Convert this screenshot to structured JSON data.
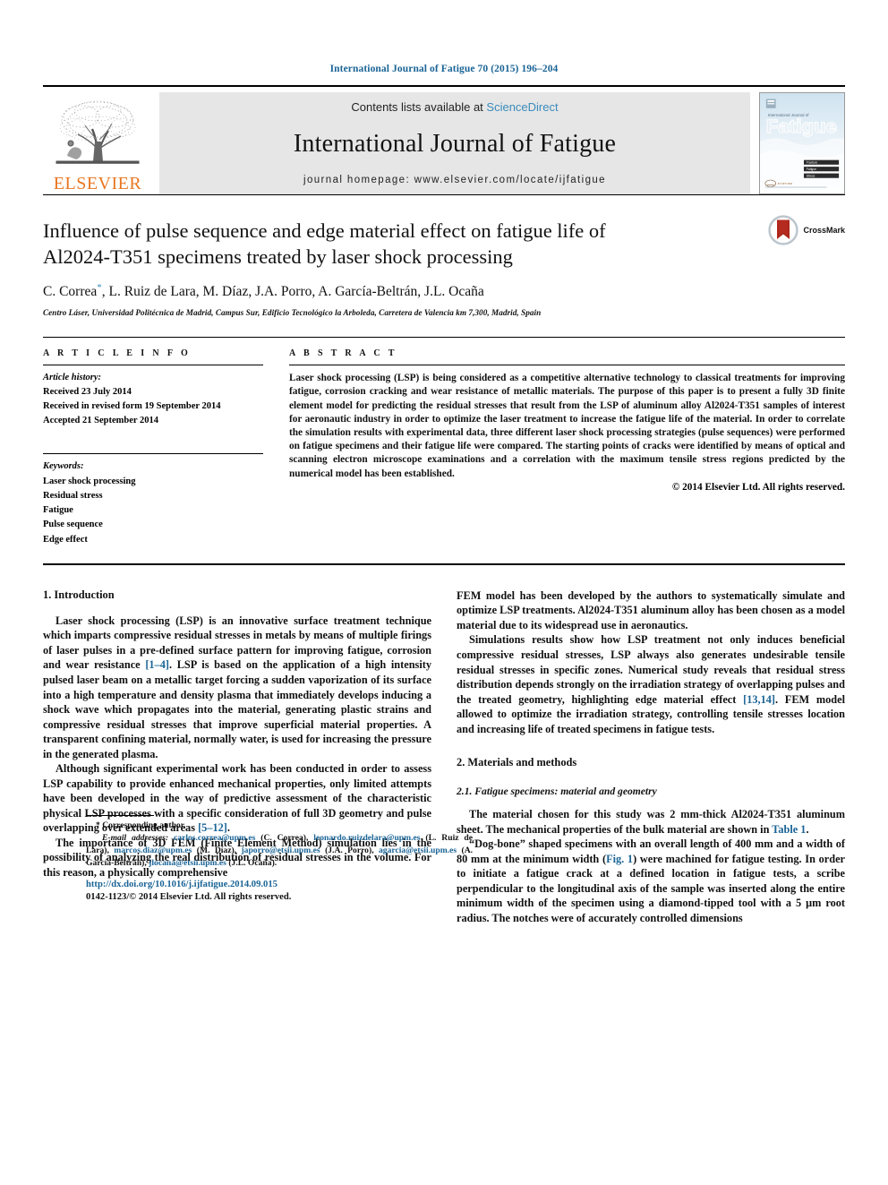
{
  "running_head": "International Journal of Fatigue 70 (2015) 196–204",
  "masthead": {
    "contents_prefix": "Contents lists available at ",
    "sciencedirect": "ScienceDirect",
    "journal_title": "International Journal of Fatigue",
    "homepage": "journal homepage: www.elsevier.com/locate/ijfatigue",
    "publisher": "ELSEVIER",
    "cover": {
      "kicker": "International Journal of",
      "title": "Fatigue",
      "bullets": [
        "Fracture",
        "Fatigue",
        "Stress"
      ]
    }
  },
  "article": {
    "title": "Influence of pulse sequence and edge material effect on fatigue life of Al2024-T351 specimens treated by laser shock processing",
    "authors": "C. Correa , L. Ruiz de Lara, M. Díaz, J.A. Porro, A. García-Beltrán, J.L. Ocaña",
    "corresponding_marker": "*",
    "affiliation": "Centro Láser, Universidad Politécnica de Madrid, Campus Sur, Edificio Tecnológico la Arboleda, Carretera de Valencia km 7,300, Madrid, Spain",
    "crossmark_label": "CrossMark"
  },
  "info": {
    "heading": "A R T I C L E    I N F O",
    "history_title": "Article history:",
    "history": [
      "Received 23 July 2014",
      "Received in revised form 19 September 2014",
      "Accepted 21 September 2014"
    ],
    "keywords_title": "Keywords:",
    "keywords": [
      "Laser shock processing",
      "Residual stress",
      "Fatigue",
      "Pulse sequence",
      "Edge effect"
    ]
  },
  "abstract": {
    "heading": "A B S T R A C T",
    "text": "Laser shock processing (LSP) is being considered as a competitive alternative technology to classical treatments for improving fatigue, corrosion cracking and wear resistance of metallic materials. The purpose of this paper is to present a fully 3D finite element model for predicting the residual stresses that result from the LSP of aluminum alloy Al2024-T351 samples of interest for aeronautic industry in order to optimize the laser treatment to increase the fatigue life of the material. In order to correlate the simulation results with experimental data, three different laser shock processing strategies (pulse sequences) were performed on fatigue specimens and their fatigue life were compared. The starting points of cracks were identified by means of optical and scanning electron microscope examinations and a correlation with the maximum tensile stress regions predicted by the numerical model has been established.",
    "copyright": "© 2014 Elsevier Ltd. All rights reserved."
  },
  "body": {
    "section1_heading": "1. Introduction",
    "p1_a": "Laser shock processing (LSP) is an innovative surface treatment technique which imparts compressive residual stresses in metals by means of multiple firings of laser pulses in a pre-defined surface pattern for improving fatigue, corrosion and wear resistance ",
    "p1_ref": "[1–4]",
    "p1_b": ". LSP is based on the application of a high intensity pulsed laser beam on a metallic target forcing a sudden vaporization of its surface into a high temperature and density plasma that immediately develops inducing a shock wave which propagates into the material, generating plastic strains and compressive residual stresses that improve superficial material properties. A transparent confining material, normally water, is used for increasing the pressure in the generated plasma.",
    "p2_a": "Although significant experimental work has been conducted in order to assess LSP capability to provide enhanced mechanical properties, only limited attempts have been developed in the way of predictive assessment of the characteristic physical LSP processes with a specific consideration of full 3D geometry and pulse overlapping over extended areas ",
    "p2_ref": "[5–12]",
    "p2_b": ".",
    "p3": "The importance of 3D FEM (Finite Element Method) simulation lies in the possibility of analyzing the real distribution of residual stresses in the volume. For this reason, a physically comprehensive",
    "p4": "FEM model has been developed by the authors to systematically simulate and optimize LSP treatments. Al2024-T351 aluminum alloy has been chosen as a model material due to its widespread use in aeronautics.",
    "p5_a": "Simulations results show how LSP treatment not only induces beneficial compressive residual stresses, LSP always also generates undesirable tensile residual stresses in specific zones. Numerical study reveals that residual stress distribution depends strongly on the irradiation strategy of overlapping pulses and the treated geometry, highlighting edge material effect ",
    "p5_ref": "[13,14]",
    "p5_b": ". FEM model allowed to optimize the irradiation strategy, controlling tensile stresses location and increasing life of treated specimens in fatigue tests.",
    "section2_heading": "2. Materials and methods",
    "subsection21_heading": "2.1. Fatigue specimens: material and geometry",
    "p6_a": "The material chosen for this study was 2 mm-thick Al2024-T351 aluminum sheet. The mechanical properties of the bulk material are shown in ",
    "p6_ref": "Table 1",
    "p6_b": ".",
    "p7_a": "“Dog-bone” shaped specimens with an overall length of 400 mm and a width of 80 mm at the minimum width (",
    "p7_ref": "Fig. 1",
    "p7_b": ") were machined for fatigue testing. In order to initiate a fatigue crack at a defined location in fatigue tests, a scribe perpendicular to the longitudinal axis of the sample was inserted along the entire minimum width of the specimen using a diamond-tipped tool with a 5 μm root radius. The notches were of accurately controlled dimensions"
  },
  "footnote": {
    "corresponding": "* Corresponding author.",
    "emails_label": "E-mail addresses:",
    "entries": [
      {
        "mail": "carlos.correa@upm.es",
        "name": "(C. Correa)"
      },
      {
        "mail": "leonardo.ruizdelara@upm.es",
        "name": "(L. Ruiz de Lara)"
      },
      {
        "mail": "marcos.diaz@upm.es",
        "name": "(M. Díaz)"
      },
      {
        "mail": "japorro@etsii.upm.es",
        "name": "(J.A. Porro)"
      },
      {
        "mail": "agarcia@etsii.upm.es",
        "name": "(A. García-Beltrán)"
      },
      {
        "mail": "jlocana@etsii.upm.es",
        "name": "(J.L. Ocaña)."
      }
    ]
  },
  "doi": {
    "url": "http://dx.doi.org/10.1016/j.ijfatigue.2014.09.015",
    "issn_line": "0142-1123/© 2014 Elsevier Ltd. All rights reserved."
  },
  "colors": {
    "link": "#1a6496",
    "sciencedirect": "#3a8bbb",
    "elsevier_orange": "#E87722",
    "masthead_bg": "#e6e6e6"
  }
}
